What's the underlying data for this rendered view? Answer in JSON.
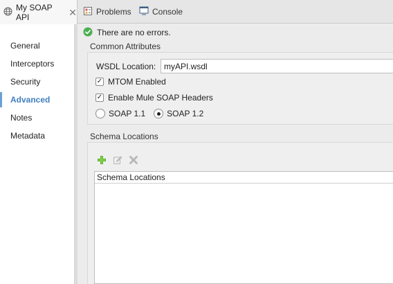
{
  "tabs": [
    {
      "label": "My SOAP API",
      "icon": "globe-icon",
      "active": true
    },
    {
      "label": "Problems",
      "icon": "problems-icon"
    },
    {
      "label": "Console",
      "icon": "console-icon"
    }
  ],
  "nav": {
    "items": [
      {
        "label": "General"
      },
      {
        "label": "Interceptors"
      },
      {
        "label": "Security"
      },
      {
        "label": "Advanced",
        "active": true
      },
      {
        "label": "Notes"
      },
      {
        "label": "Metadata"
      }
    ],
    "active_color": "#3f7fbf"
  },
  "status": {
    "message": "There are no errors.",
    "icon": "check-circle-icon",
    "color": "#4caf50"
  },
  "common_attributes": {
    "title": "Common Attributes",
    "wsdl_label": "WSDL Location:",
    "wsdl_value": "myAPI.wsdl",
    "mtom": {
      "label": "MTOM Enabled",
      "checked": true
    },
    "mule_headers": {
      "label": "Enable Mule SOAP Headers",
      "checked": true
    },
    "soap_versions": [
      {
        "label": "SOAP 1.1",
        "selected": false
      },
      {
        "label": "SOAP 1.2",
        "selected": true
      }
    ]
  },
  "schema_locations": {
    "title": "Schema Locations",
    "toolbar": [
      "add-icon",
      "edit-icon",
      "delete-icon"
    ],
    "columns": [
      "Schema Locations"
    ],
    "rows": []
  }
}
